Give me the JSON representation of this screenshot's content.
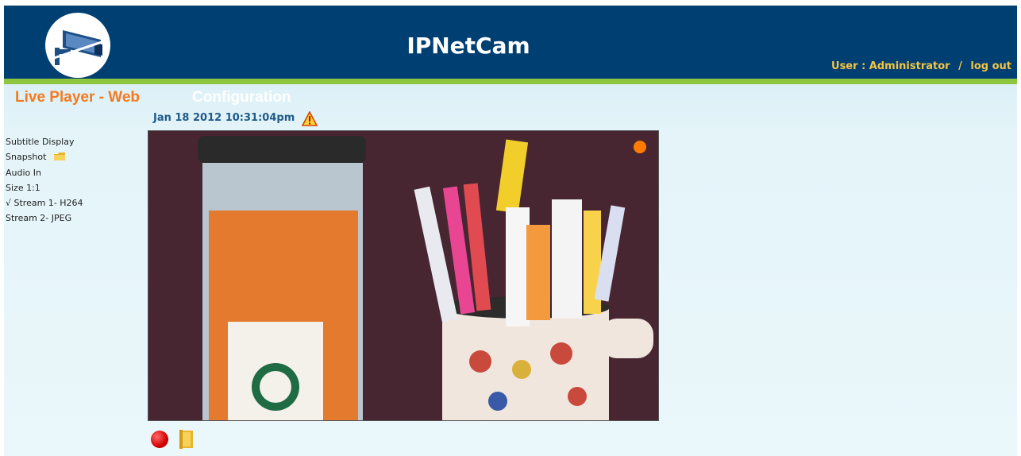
{
  "header": {
    "title": "IPNetCam",
    "user_label": "User : Administrator",
    "separator": "/",
    "logout": "log out"
  },
  "tabs": {
    "live": "Live Player - Web",
    "config": "Configuration"
  },
  "timestamp": "Jan 18 2012 10:31:04pm",
  "menu": {
    "subtitle": "Subtitle Display",
    "snapshot": "Snapshot",
    "audio": "Audio In",
    "size": "Size 1:1",
    "stream1": "√ Stream 1- H264",
    "stream2": "Stream 2- JPEG"
  },
  "icons": {
    "logo": "camera-logo-icon",
    "warning": "warning-icon",
    "snapshot": "folder-icon",
    "record": "record-icon",
    "record_folder": "folder-icon"
  },
  "colors": {
    "header": "#003f72",
    "accent_green": "#8dc63f",
    "active_tab": "#f47a1f",
    "user_text": "#f5c542",
    "timestamp": "#1f5a8a"
  }
}
